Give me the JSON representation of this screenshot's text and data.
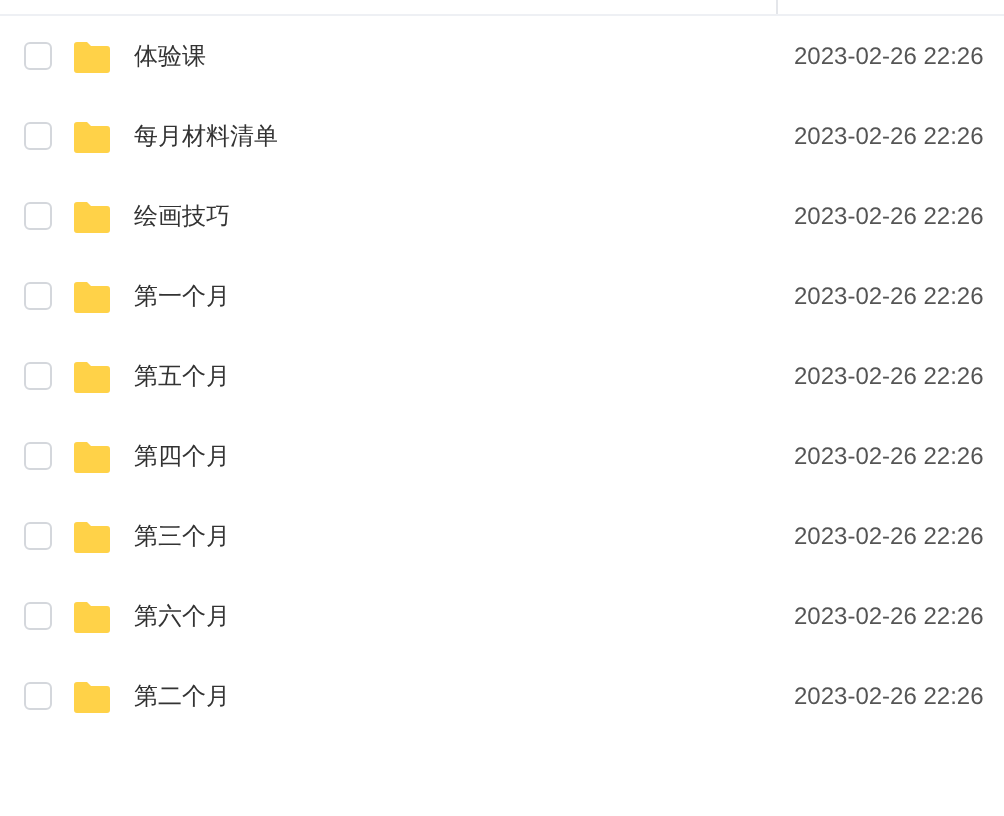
{
  "files": [
    {
      "name": "体验课",
      "modified": "2023-02-26 22:26",
      "checked": false
    },
    {
      "name": "每月材料清单",
      "modified": "2023-02-26 22:26",
      "checked": false
    },
    {
      "name": "绘画技巧",
      "modified": "2023-02-26 22:26",
      "checked": false
    },
    {
      "name": "第一个月",
      "modified": "2023-02-26 22:26",
      "checked": false
    },
    {
      "name": "第五个月",
      "modified": "2023-02-26 22:26",
      "checked": false
    },
    {
      "name": "第四个月",
      "modified": "2023-02-26 22:26",
      "checked": false
    },
    {
      "name": "第三个月",
      "modified": "2023-02-26 22:26",
      "checked": false
    },
    {
      "name": "第六个月",
      "modified": "2023-02-26 22:26",
      "checked": false
    },
    {
      "name": "第二个月",
      "modified": "2023-02-26 22:26",
      "checked": false
    }
  ]
}
